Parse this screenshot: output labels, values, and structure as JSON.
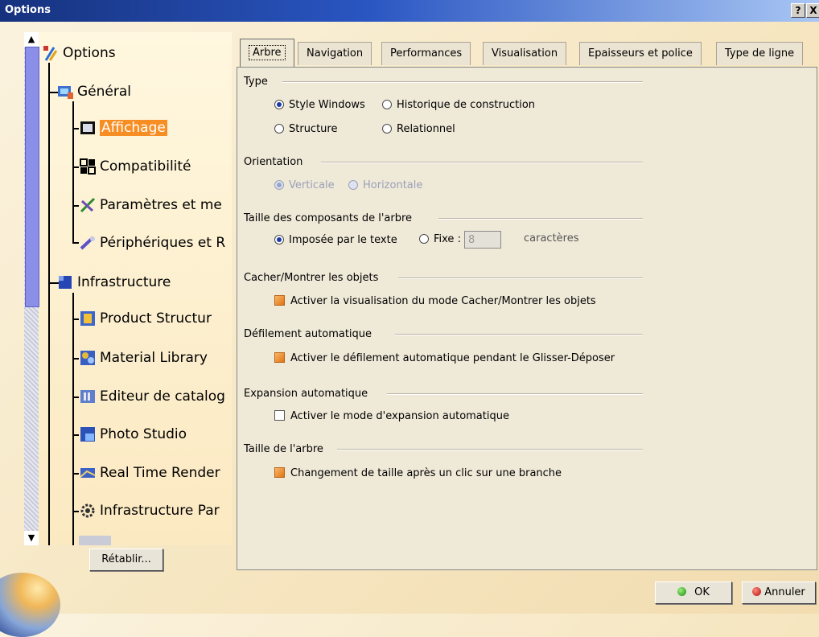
{
  "window": {
    "title": "Options",
    "help_label": "?",
    "close_label": "X"
  },
  "tree": {
    "root": "Options",
    "items": [
      {
        "label": "Général"
      },
      {
        "label": "Affichage"
      },
      {
        "label": "Compatibilité"
      },
      {
        "label": "Paramètres et me"
      },
      {
        "label": "Périphériques et R"
      },
      {
        "label": "Infrastructure"
      },
      {
        "label": "Product Structur"
      },
      {
        "label": "Material Library"
      },
      {
        "label": "Editeur de catalog"
      },
      {
        "label": "Photo Studio"
      },
      {
        "label": "Real Time Render"
      },
      {
        "label": "Infrastructure Par"
      }
    ]
  },
  "reset_label": "Rétablir...",
  "tabs": [
    "Arbre",
    "Navigation",
    "Performances",
    "Visualisation",
    "Epaisseurs et police",
    "Type de ligne"
  ],
  "groups": {
    "type": {
      "label": "Type",
      "options": [
        "Style Windows",
        "Historique de construction",
        "Structure",
        "Relationnel"
      ],
      "selected": "Style Windows"
    },
    "orientation": {
      "label": "Orientation",
      "options": [
        "Verticale",
        "Horizontale"
      ],
      "selected": "Verticale",
      "enabled": false
    },
    "size": {
      "label": "Taille des composants de l'arbre",
      "option_text": "Imposée par le texte",
      "option_fixed": "Fixe :",
      "fixed_value": "8",
      "unit": "caractères",
      "selected": "Imposée par le texte"
    },
    "hide_show": {
      "label": "Cacher/Montrer les objets",
      "checkbox": "Activer la visualisation du mode Cacher/Montrer les objets",
      "checked": true
    },
    "autoscroll": {
      "label": "Défilement automatique",
      "checkbox": "Activer le défilement automatique pendant le Glisser-Déposer",
      "checked": true
    },
    "expansion": {
      "label": "Expansion automatique",
      "checkbox": "Activer le mode d'expansion automatique",
      "checked": false
    },
    "tree_size": {
      "label": "Taille de l'arbre",
      "checkbox": "Changement de taille après un clic sur une branche",
      "checked": true
    }
  },
  "buttons": {
    "ok": "OK",
    "cancel": "Annuler"
  }
}
